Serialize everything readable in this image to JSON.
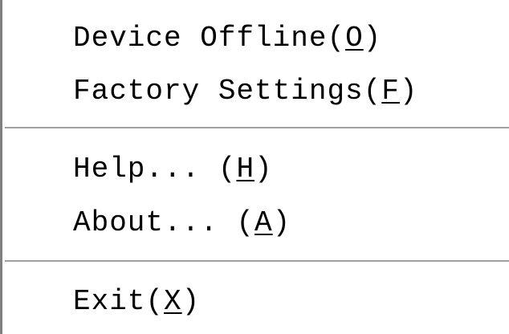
{
  "menu": {
    "items": [
      {
        "pre": "Device Offline(",
        "key": "O",
        "post": ")"
      },
      {
        "pre": "Factory Settings(",
        "key": "F",
        "post": ")"
      },
      {
        "pre": "Help... (",
        "key": "H",
        "post": ")"
      },
      {
        "pre": "About... (",
        "key": "A",
        "post": ")"
      },
      {
        "pre": "Exit(",
        "key": "X",
        "post": ")"
      }
    ]
  }
}
